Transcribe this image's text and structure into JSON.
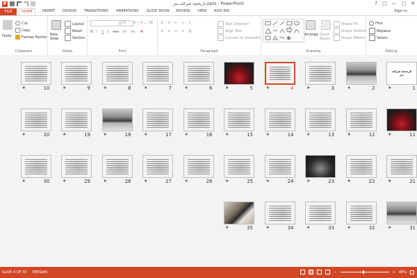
{
  "window": {
    "title": "ناریخچه شرکت بنز.pptx - PowerPoint",
    "help": "?",
    "controls": [
      "▢",
      "—",
      "▢",
      "✕"
    ],
    "signin": "Sign in"
  },
  "tabs": {
    "file": "FILE",
    "items": [
      "HOME",
      "INSERT",
      "DESIGN",
      "TRANSITIONS",
      "ANIMATIONS",
      "SLIDE SHOW",
      "REVIEW",
      "VIEW",
      "ADD-INS"
    ]
  },
  "ribbon": {
    "clipboard": {
      "label": "Clipboard",
      "paste": "Paste",
      "cut": "Cut",
      "copy": "Copy",
      "format_painter": "Format Painter"
    },
    "slides": {
      "label": "Slides",
      "new_slide": "New Slide",
      "layout": "Layout",
      "reset": "Reset",
      "section": "Section"
    },
    "font": {
      "label": "Font",
      "size": "24"
    },
    "paragraph": {
      "label": "Paragraph",
      "text_direction": "Text Direction",
      "align_text": "Align Text",
      "convert_smartart": "Convert to SmartArt"
    },
    "drawing": {
      "label": "Drawing",
      "arrange": "Arrange",
      "quick_styles": "Quick Styles",
      "shape_fill": "Shape Fill",
      "shape_outline": "Shape Outline",
      "shape_effects": "Shape Effects"
    },
    "editing": {
      "label": "Editing",
      "find": "Find",
      "replace": "Replace",
      "select": "Select"
    }
  },
  "slides": [
    {
      "num": "1",
      "kind": "title-slide",
      "title": "تاریخچه شرکت بنز"
    },
    {
      "num": "2",
      "kind": "photo-car"
    },
    {
      "num": "3",
      "kind": "text"
    },
    {
      "num": "4",
      "kind": "text",
      "selected": true
    },
    {
      "num": "5",
      "kind": "photo-red"
    },
    {
      "num": "6",
      "kind": "text"
    },
    {
      "num": "7",
      "kind": "text"
    },
    {
      "num": "8",
      "kind": "text"
    },
    {
      "num": "9",
      "kind": "text"
    },
    {
      "num": "10",
      "kind": "text"
    },
    {
      "num": "11",
      "kind": "photo-red"
    },
    {
      "num": "12",
      "kind": "text"
    },
    {
      "num": "13",
      "kind": "text"
    },
    {
      "num": "14",
      "kind": "text"
    },
    {
      "num": "15",
      "kind": "text"
    },
    {
      "num": "16",
      "kind": "text"
    },
    {
      "num": "17",
      "kind": "text"
    },
    {
      "num": "18",
      "kind": "photo-car"
    },
    {
      "num": "19",
      "kind": "text"
    },
    {
      "num": "20",
      "kind": "text"
    },
    {
      "num": "21",
      "kind": "text"
    },
    {
      "num": "22",
      "kind": "text"
    },
    {
      "num": "23",
      "kind": "photo-car2"
    },
    {
      "num": "24",
      "kind": "text"
    },
    {
      "num": "25",
      "kind": "text"
    },
    {
      "num": "26",
      "kind": "text"
    },
    {
      "num": "27",
      "kind": "text"
    },
    {
      "num": "28",
      "kind": "text"
    },
    {
      "num": "29",
      "kind": "text"
    },
    {
      "num": "30",
      "kind": "text"
    },
    {
      "num": "31",
      "kind": "photo-car"
    },
    {
      "num": "32",
      "kind": "text"
    },
    {
      "num": "33",
      "kind": "text"
    },
    {
      "num": "34",
      "kind": "text"
    },
    {
      "num": "35",
      "kind": "photo-laptop"
    }
  ],
  "star": "★",
  "status": {
    "slide_info": "SLIDE 4 OF 35",
    "language": "PERSIAN",
    "zoom": "48%",
    "zoom_fraction": 0.48
  },
  "colors": {
    "accent": "#d24726"
  }
}
